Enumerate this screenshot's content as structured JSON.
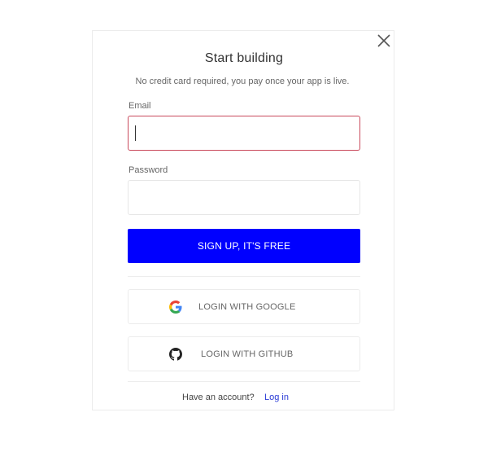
{
  "dialog": {
    "title": "Start building",
    "subtitle": "No credit card required, you pay once your app is live."
  },
  "form": {
    "email_label": "Email",
    "email_value": "",
    "email_placeholder": "",
    "password_label": "Password",
    "password_value": "",
    "password_placeholder": "",
    "submit_label": "SIGN UP, IT'S FREE"
  },
  "social": {
    "google_label": "LOGIN WITH GOOGLE",
    "github_label": "LOGIN WITH GITHUB"
  },
  "footer": {
    "text": "Have an account?",
    "link_label": "Log in"
  },
  "colors": {
    "primary": "#0000ff",
    "focus_border": "#c94a5c",
    "link": "#2a3bd6"
  },
  "icons": [
    "close-icon",
    "google-icon",
    "github-icon"
  ]
}
